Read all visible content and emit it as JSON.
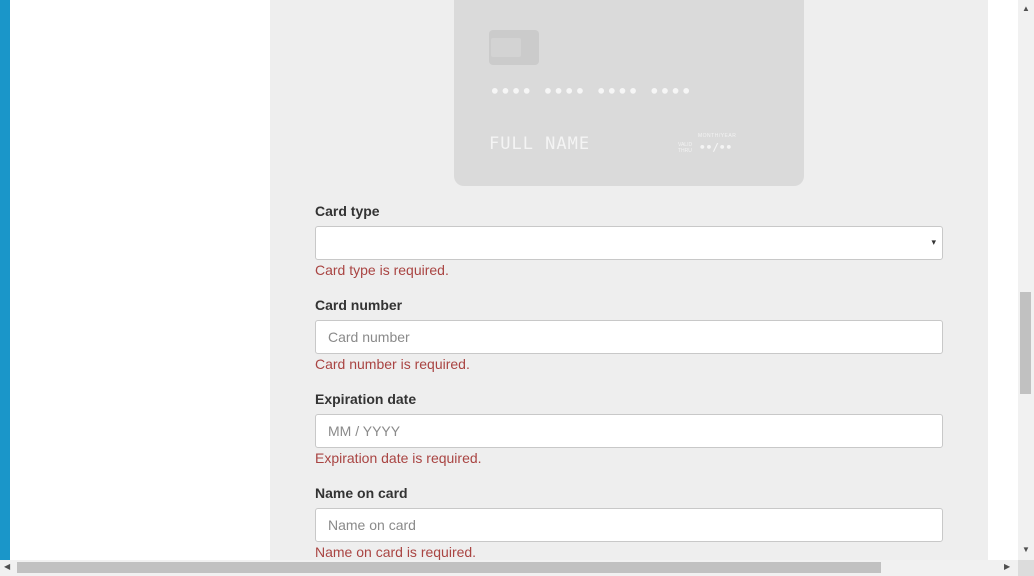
{
  "card_preview": {
    "number": "•••• •••• •••• ••••",
    "name": "FULL NAME",
    "valid_label": "MONTH/YEAR",
    "good_thru": "VALID THRU",
    "expiry": "••/••"
  },
  "form": {
    "card_type": {
      "label": "Card type",
      "value": "",
      "error": "Card type is required."
    },
    "card_number": {
      "label": "Card number",
      "placeholder": "Card number",
      "error": "Card number is required."
    },
    "expiration_date": {
      "label": "Expiration date",
      "placeholder": "MM / YYYY",
      "error": "Expiration date is required."
    },
    "name_on_card": {
      "label": "Name on card",
      "placeholder": "Name on card",
      "error": "Name on card is required."
    }
  },
  "icons": {
    "select_arrow": "▾",
    "scroll_up": "▲",
    "scroll_down": "▼",
    "scroll_left": "◀",
    "scroll_right": "▶"
  },
  "colors": {
    "accent_edge": "#1a96c9",
    "error": "#a94442",
    "panel_bg": "#eeeeee",
    "card_bg": "#dadada"
  }
}
